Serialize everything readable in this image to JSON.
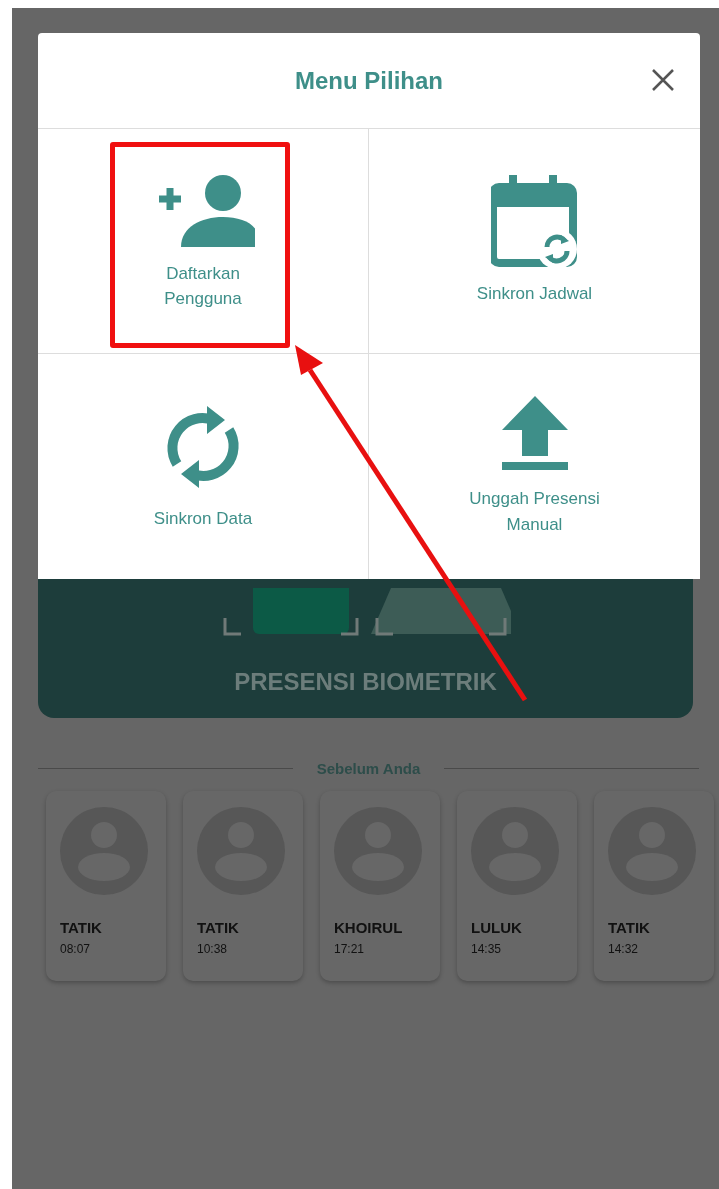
{
  "background": {
    "banner_title": "PRESENSI BIOMETRIK",
    "section_title": "Sebelum Anda",
    "recent_users": [
      {
        "name": "TATIK",
        "time": "08:07"
      },
      {
        "name": "TATIK",
        "time": "10:38"
      },
      {
        "name": "KHOIRUL",
        "time": "17:21"
      },
      {
        "name": "LULUK",
        "time": "14:35"
      },
      {
        "name": "TATIK",
        "time": "14:32"
      }
    ]
  },
  "dialog": {
    "title": "Menu Pilihan",
    "items": [
      {
        "kind": "add-user",
        "label": "Daftarkan Pengguna",
        "selected": true
      },
      {
        "kind": "calendar-sync",
        "label": "Sinkron Jadwal",
        "selected": false
      },
      {
        "kind": "sync",
        "label": "Sinkron Data",
        "selected": false
      },
      {
        "kind": "upload",
        "label": "Unggah Presensi Manual",
        "selected": false
      }
    ]
  }
}
